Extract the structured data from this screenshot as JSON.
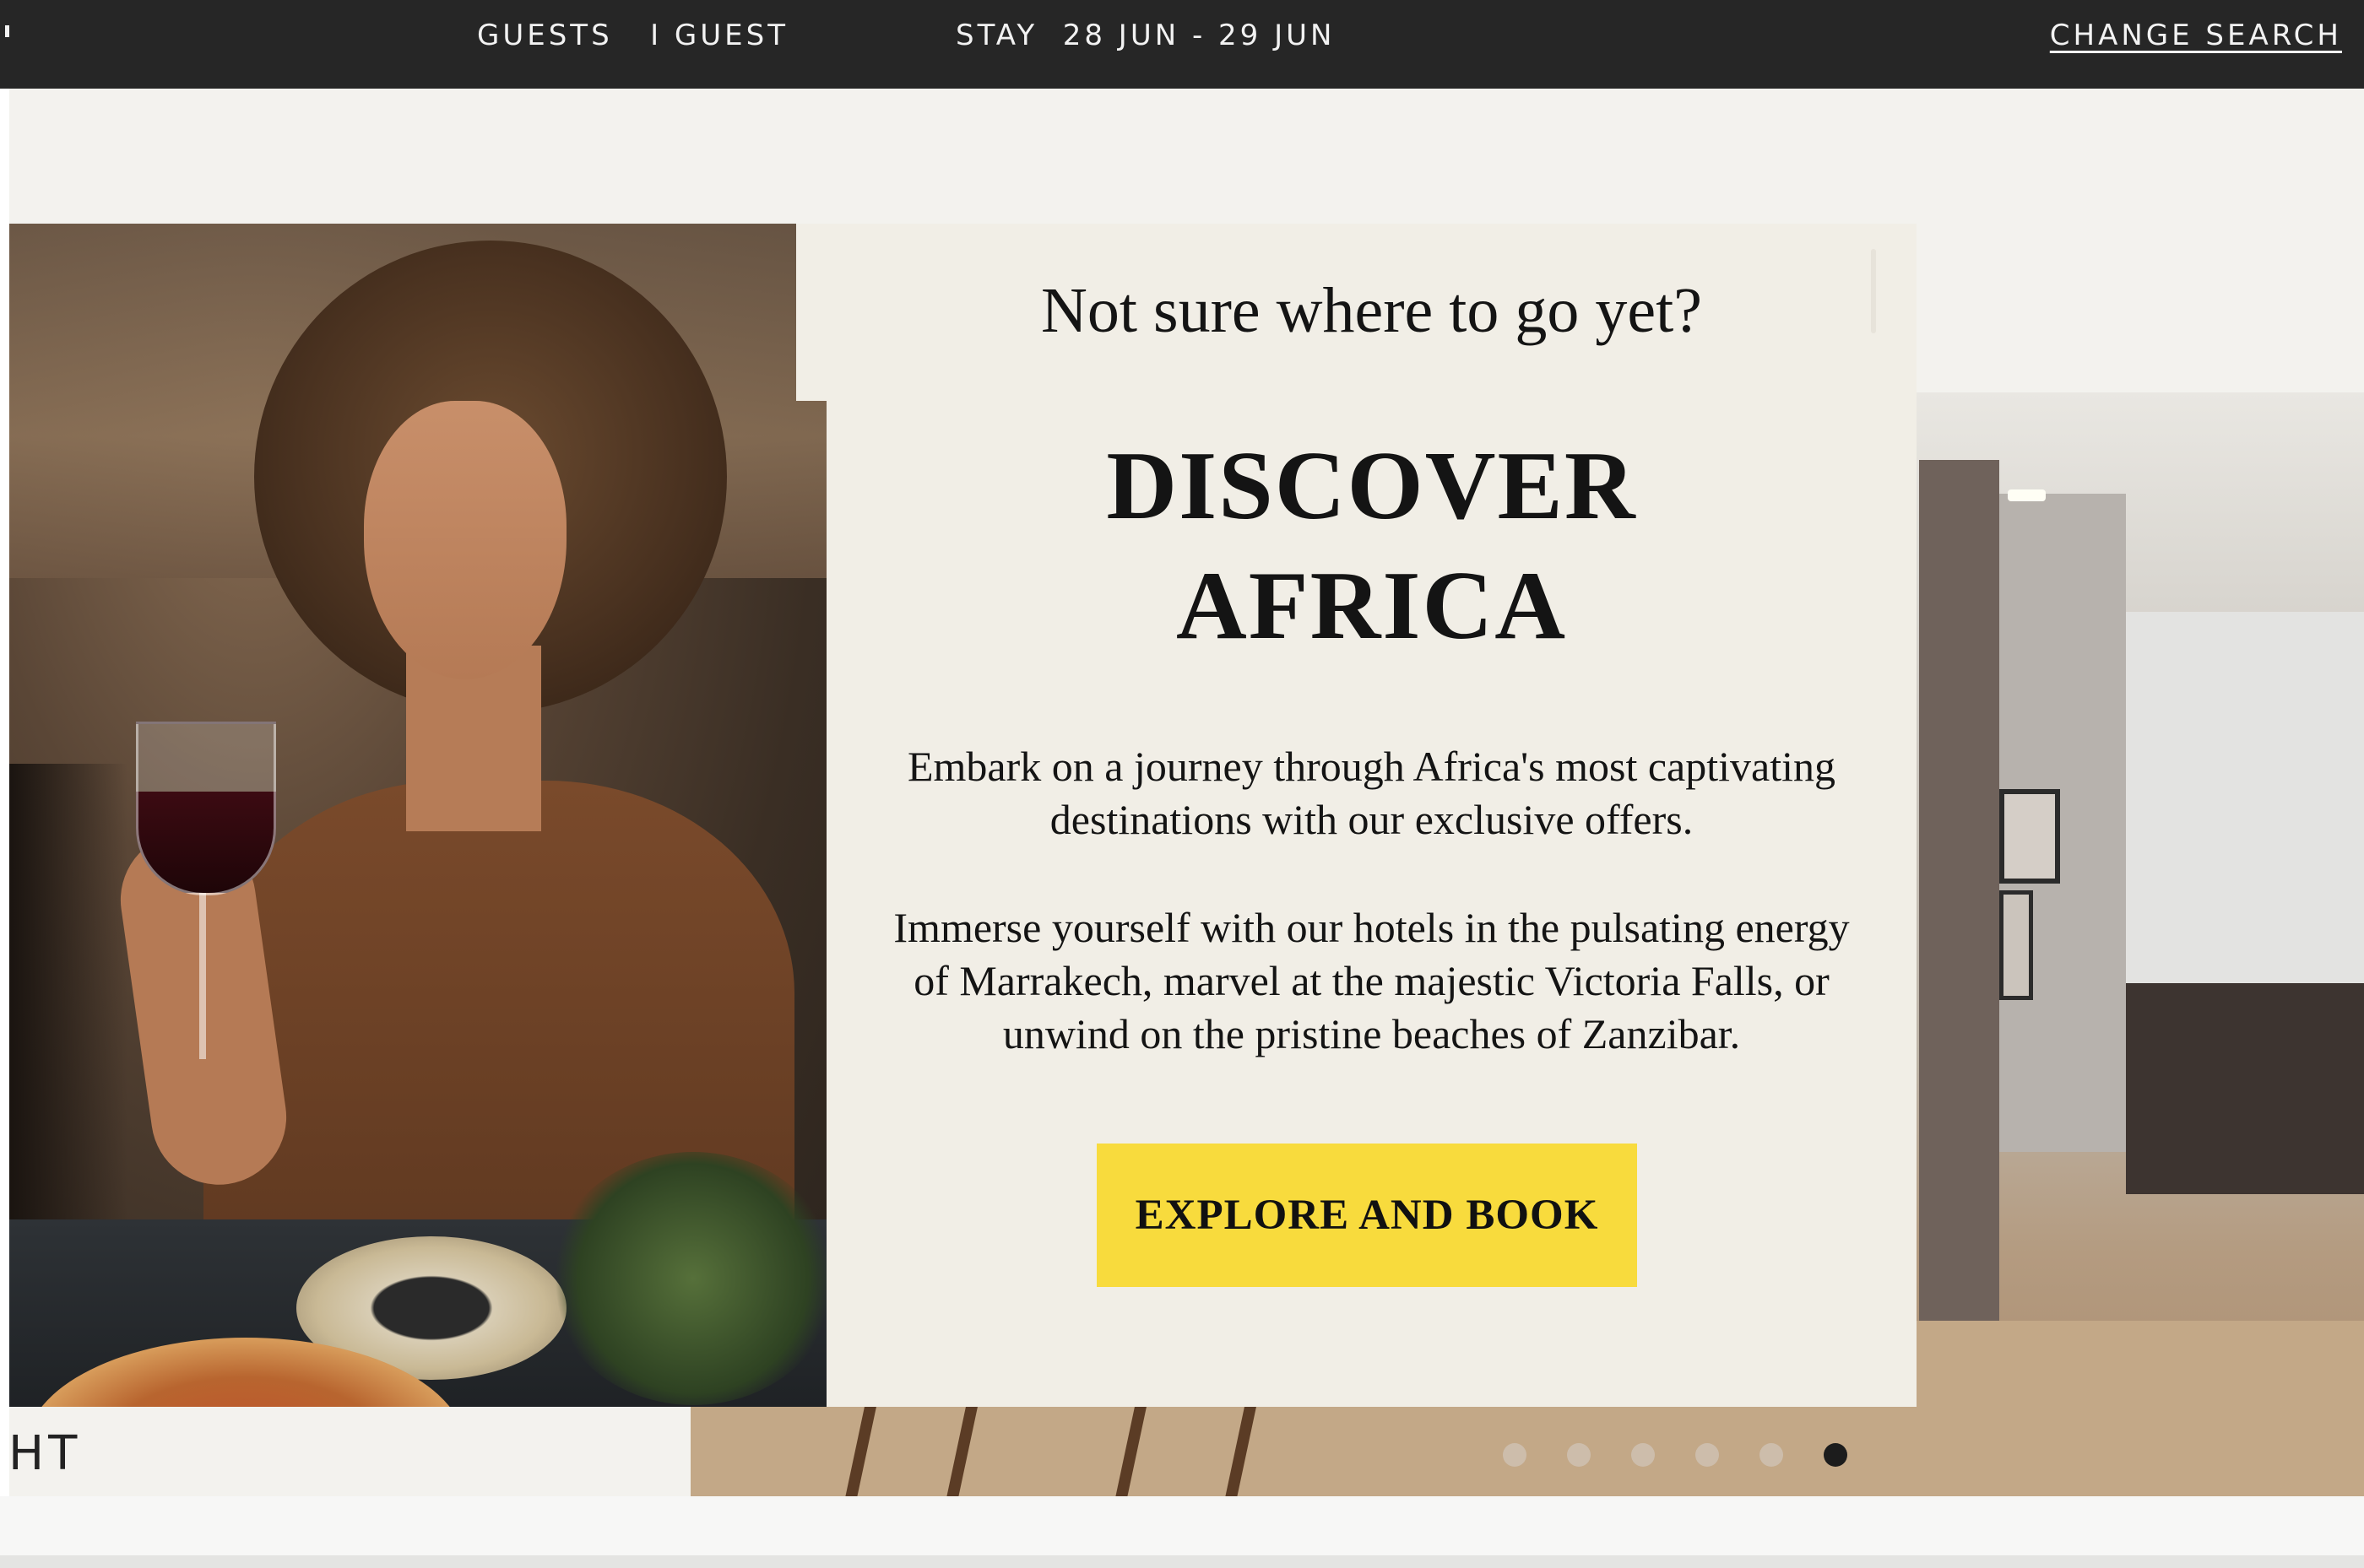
{
  "header": {
    "guests_label": "GUESTS",
    "guests_value": "I GUEST",
    "stay_label": "STAY",
    "stay_value": "28 JUN - 29 JUN",
    "change_search": "CHANGE SEARCH"
  },
  "modal": {
    "kicker": "Not sure where to go yet?",
    "headline_line1": "DISCOVER",
    "headline_line2": "AFRICA",
    "paragraph1": "Embark on a journey through Africa's most captivating destinations with our exclusive offers.",
    "paragraph2": "Immerse yourself with our hotels in the pulsating energy of Marrakech, marvel at the majestic Victoria Falls, or unwind on the pristine beaches of Zanzibar.",
    "cta_label": "EXPLORE AND BOOK",
    "cta_color": "#f8db3d"
  },
  "page": {
    "side_text": "HT"
  },
  "carousel": {
    "dot_count": 6,
    "active_index": 5
  },
  "colors": {
    "topbar": "#262626",
    "card_background": "#f1eee6"
  }
}
